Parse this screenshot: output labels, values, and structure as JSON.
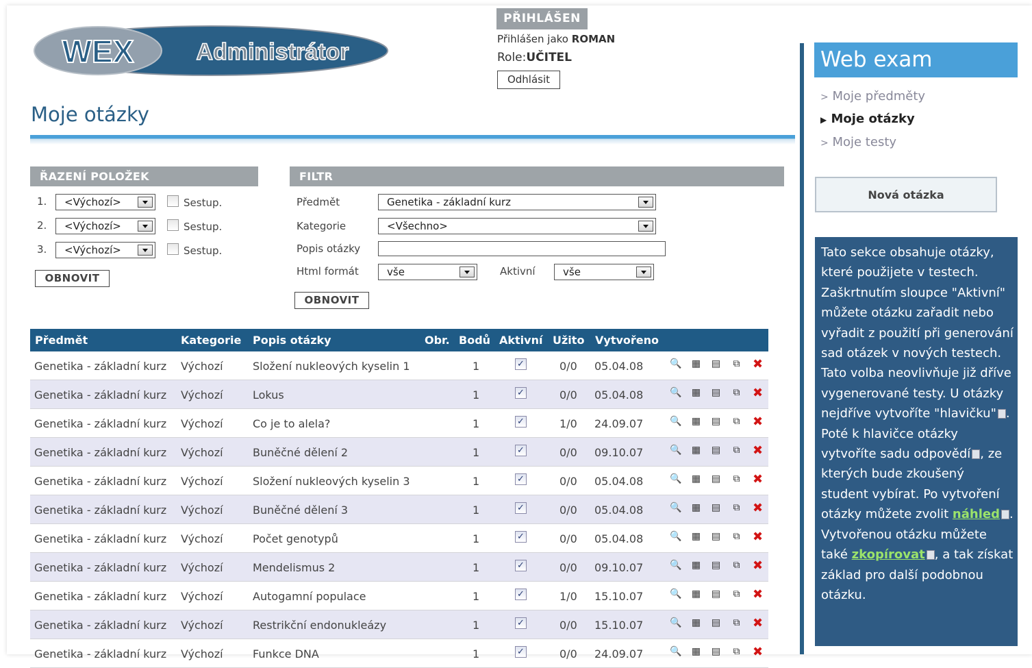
{
  "logo": {
    "left": "WEX",
    "right": "Administrátor"
  },
  "login": {
    "badge": "PŘIHLÁŠEN",
    "user_prefix": "Přihlášen jako ",
    "user_name": "ROMAN",
    "role_prefix": "Role:",
    "role_value": "UČITEL",
    "logout": "Odhlásit"
  },
  "page_title": "Moje otázky",
  "sort": {
    "heading": "ŘAZENÍ POLOŽEK",
    "rows": [
      {
        "num": "1.",
        "value": "<Výchozí>",
        "desc_label": "Sestup."
      },
      {
        "num": "2.",
        "value": "<Výchozí>",
        "desc_label": "Sestup."
      },
      {
        "num": "3.",
        "value": "<Výchozí>",
        "desc_label": "Sestup."
      }
    ],
    "refresh": "OBNOVIT"
  },
  "filter": {
    "heading": "FILTR",
    "subject_label": "Předmět",
    "subject_value": "Genetika - základní kurz",
    "category_label": "Kategorie",
    "category_value": "<Všechno>",
    "desc_label": "Popis otázky",
    "desc_value": "",
    "html_label": "Html formát",
    "html_value": "vše",
    "active_label": "Aktivní",
    "active_value": "vše",
    "refresh": "OBNOVIT"
  },
  "table": {
    "headers": [
      "Předmět",
      "Kategorie",
      "Popis otázky",
      "Obr.",
      "Bodů",
      "Aktivní",
      "Užito",
      "Vytvořeno"
    ],
    "rows": [
      {
        "subject": "Genetika - základní kurz",
        "category": "Výchozí",
        "desc": "Složení nukleových kyselin 1",
        "points": "1",
        "active": true,
        "used": "0/0",
        "created": "05.04.08"
      },
      {
        "subject": "Genetika - základní kurz",
        "category": "Výchozí",
        "desc": "Lokus",
        "points": "1",
        "active": true,
        "used": "0/0",
        "created": "05.04.08"
      },
      {
        "subject": "Genetika - základní kurz",
        "category": "Výchozí",
        "desc": "Co je to alela?",
        "points": "1",
        "active": true,
        "used": "1/0",
        "created": "24.09.07"
      },
      {
        "subject": "Genetika - základní kurz",
        "category": "Výchozí",
        "desc": "Buněčné dělení 2",
        "points": "1",
        "active": true,
        "used": "0/0",
        "created": "09.10.07"
      },
      {
        "subject": "Genetika - základní kurz",
        "category": "Výchozí",
        "desc": "Složení nukleových kyselin 3",
        "points": "1",
        "active": true,
        "used": "0/0",
        "created": "05.04.08"
      },
      {
        "subject": "Genetika - základní kurz",
        "category": "Výchozí",
        "desc": "Buněčné dělení 3",
        "points": "1",
        "active": true,
        "used": "0/0",
        "created": "05.04.08"
      },
      {
        "subject": "Genetika - základní kurz",
        "category": "Výchozí",
        "desc": "Počet genotypů",
        "points": "1",
        "active": true,
        "used": "0/0",
        "created": "05.04.08"
      },
      {
        "subject": "Genetika - základní kurz",
        "category": "Výchozí",
        "desc": "Mendelismus 2",
        "points": "1",
        "active": true,
        "used": "0/0",
        "created": "09.10.07"
      },
      {
        "subject": "Genetika - základní kurz",
        "category": "Výchozí",
        "desc": "Autogamní populace",
        "points": "1",
        "active": true,
        "used": "1/0",
        "created": "15.10.07"
      },
      {
        "subject": "Genetika - základní kurz",
        "category": "Výchozí",
        "desc": "Restrikční endonukleázy",
        "points": "1",
        "active": true,
        "used": "0/0",
        "created": "15.10.07"
      },
      {
        "subject": "Genetika - základní kurz",
        "category": "Výchozí",
        "desc": "Funkce DNA",
        "points": "1",
        "active": true,
        "used": "0/0",
        "created": "24.09.07"
      }
    ],
    "action_icons": [
      "preview-icon",
      "header-edit-icon",
      "answers-icon",
      "copy-icon",
      "delete-icon"
    ]
  },
  "sidebar": {
    "title": "Web exam",
    "nav": [
      {
        "label": "Moje předměty",
        "active": false
      },
      {
        "label": "Moje otázky",
        "active": true
      },
      {
        "label": "Moje testy",
        "active": false
      }
    ],
    "new_question": "Nová otázka",
    "info_parts": {
      "p1": "Tato sekce obsahuje otázky, které použijete v testech. Zaškrtnutím sloupce \"Aktivní\" můžete otázku zařadit nebo vyřadit z použití při generování sad otázek v nových testech. Tato volba neovlivňuje již dříve vygenerované testy. U otázky nejdříve vytvoříte \"hlavičku\"",
      "p2": ". Poté k hlavičce otázky vytvoříte sadu odpovědí",
      "p3": ", ze kterých bude zkoušený student vybírat. Po vytvoření otázky můžete zvolit ",
      "link1": "náhled",
      "p4": ". Vytvořenou otázku můžete také ",
      "link2": "zkopírovat",
      "p5": ", a tak získat základ pro další podobnou otázku."
    }
  },
  "colors": {
    "brand_blue": "#2a5f86",
    "accent_blue": "#4aa0d9",
    "header_gray": "#9ea4a8",
    "delete_red": "#d21414"
  }
}
